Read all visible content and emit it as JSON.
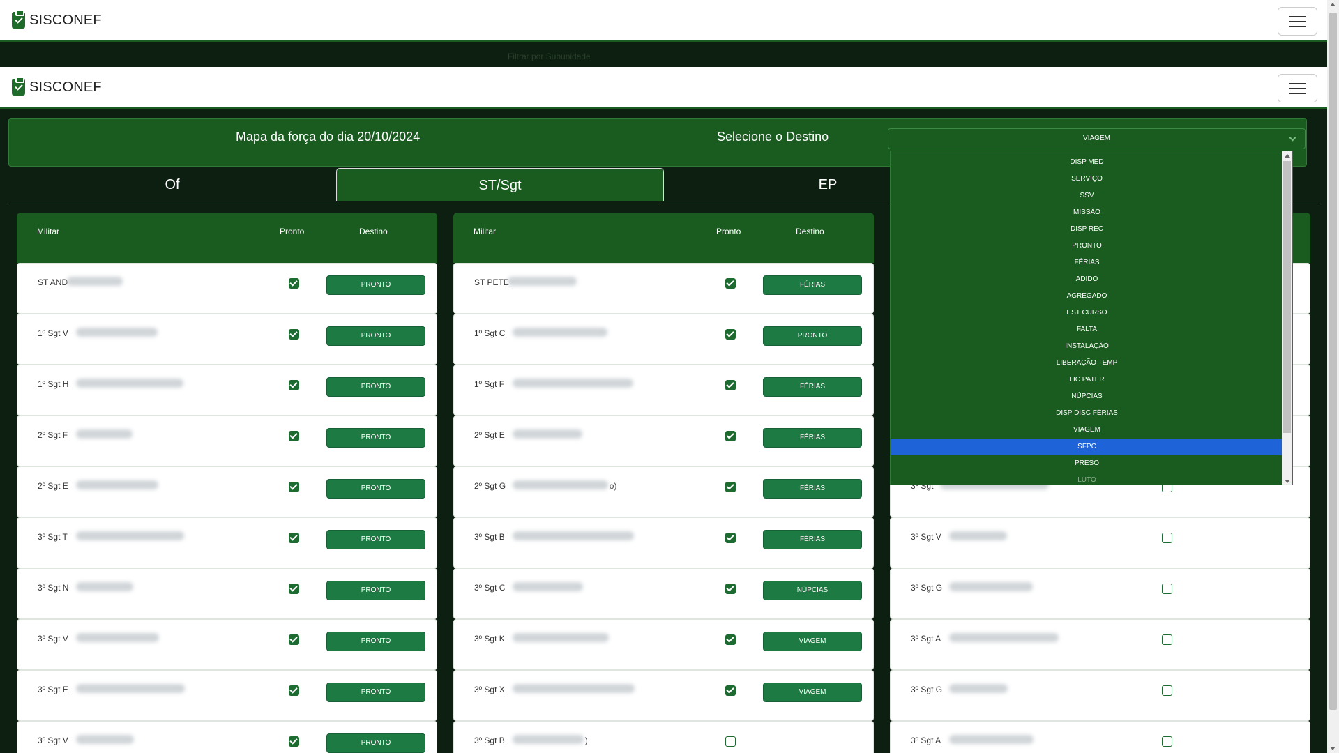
{
  "app": {
    "brand": "SISCONEF"
  },
  "filter_placeholder": "Filtrar por Subunidade",
  "header": {
    "title": "Mapa da força do dia 20/10/2024",
    "destination_label": "Selecione o Destino",
    "selected_destination": "VIAGEM"
  },
  "tabs": [
    {
      "label": "Of",
      "active": false
    },
    {
      "label": "ST/Sgt",
      "active": true
    },
    {
      "label": "EP",
      "active": false
    }
  ],
  "table_headers": {
    "militar": "Militar",
    "pronto": "Pronto",
    "destino": "Destino"
  },
  "columns": [
    {
      "rows": [
        {
          "name": "ST AND",
          "pronto": true,
          "destino": "PRONTO"
        },
        {
          "name": "1º Sgt V",
          "pronto": true,
          "destino": "PRONTO"
        },
        {
          "name": "1º Sgt H",
          "pronto": true,
          "destino": "PRONTO"
        },
        {
          "name": "2º Sgt F",
          "pronto": true,
          "destino": "PRONTO"
        },
        {
          "name": "2º Sgt E",
          "pronto": true,
          "destino": "PRONTO"
        },
        {
          "name": "3º Sgt T",
          "pronto": true,
          "destino": "PRONTO"
        },
        {
          "name": "3º Sgt N",
          "pronto": true,
          "destino": "PRONTO"
        },
        {
          "name": "3º Sgt V",
          "pronto": true,
          "destino": "PRONTO"
        },
        {
          "name": "3º Sgt E",
          "pronto": true,
          "destino": "PRONTO"
        },
        {
          "name": "3º Sgt V",
          "pronto": true,
          "destino": "PRONTO"
        }
      ]
    },
    {
      "rows": [
        {
          "name": "ST PETE",
          "pronto": true,
          "destino": "FÉRIAS"
        },
        {
          "name": "1º Sgt C",
          "pronto": true,
          "destino": "PRONTO"
        },
        {
          "name": "1º Sgt F",
          "pronto": true,
          "destino": "FÉRIAS"
        },
        {
          "name": "2º Sgt E",
          "pronto": true,
          "destino": "FÉRIAS"
        },
        {
          "name": "2º Sgt G",
          "tail": "o)",
          "pronto": true,
          "destino": "FÉRIAS"
        },
        {
          "name": "3º Sgt B",
          "pronto": true,
          "destino": "FÉRIAS"
        },
        {
          "name": "3º Sgt C",
          "pronto": true,
          "destino": "NÚPCIAS"
        },
        {
          "name": "3º Sgt K",
          "pronto": true,
          "destino": "VIAGEM"
        },
        {
          "name": "3º Sgt X",
          "pronto": true,
          "destino": "VIAGEM"
        },
        {
          "name": "3º Sgt B",
          "tail": ")",
          "pronto": false,
          "destino": ""
        }
      ]
    },
    {
      "rows": [
        {
          "name": "",
          "pronto": false,
          "destino": ""
        },
        {
          "name": "",
          "pronto": false,
          "destino": ""
        },
        {
          "name": "",
          "pronto": false,
          "destino": ""
        },
        {
          "name": "",
          "pronto": false,
          "destino": ""
        },
        {
          "name": "3º Sgt",
          "pronto": false,
          "destino": ""
        },
        {
          "name": "3º Sgt V",
          "pronto": false,
          "destino": ""
        },
        {
          "name": "3º Sgt G",
          "pronto": false,
          "destino": ""
        },
        {
          "name": "3º Sgt A",
          "pronto": false,
          "destino": ""
        },
        {
          "name": "3º Sgt G",
          "pronto": false,
          "destino": ""
        },
        {
          "name": "3º Sgt A",
          "pronto": false,
          "destino": ""
        }
      ]
    }
  ],
  "destination_options": [
    {
      "label": "DISP MED"
    },
    {
      "label": "SERVIÇO"
    },
    {
      "label": "SSV"
    },
    {
      "label": "MISSÃO"
    },
    {
      "label": "DISP REC"
    },
    {
      "label": "PRONTO"
    },
    {
      "label": "FÉRIAS"
    },
    {
      "label": "ADIDO"
    },
    {
      "label": "AGREGADO"
    },
    {
      "label": "EST CURSO"
    },
    {
      "label": "FALTA"
    },
    {
      "label": "INSTALAÇÃO"
    },
    {
      "label": "LIBERAÇÃO TEMP"
    },
    {
      "label": "LIC PATER"
    },
    {
      "label": "NÚPCIAS"
    },
    {
      "label": "DISP DISC FÉRIAS"
    },
    {
      "label": "VIAGEM"
    },
    {
      "label": "SFPC",
      "highlighted": true
    },
    {
      "label": "PRESO"
    },
    {
      "label": "LUTO",
      "partial": true
    }
  ],
  "colors": {
    "primary": "#1a5c20",
    "button": "#1e7a43",
    "highlight": "#1e63d8",
    "background": "#0d1f10"
  }
}
